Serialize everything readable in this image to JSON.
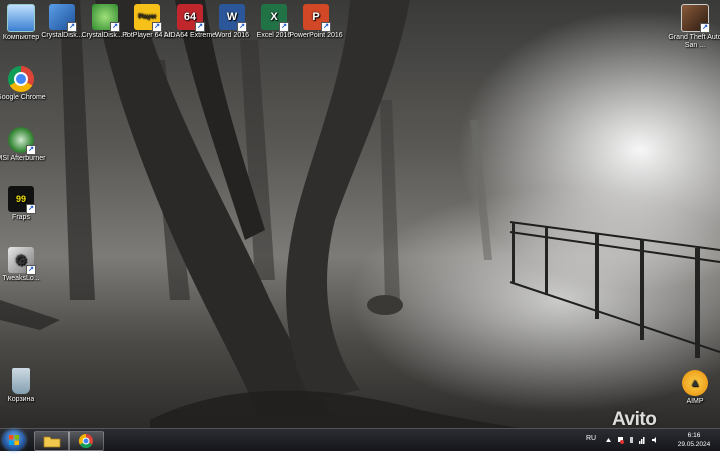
{
  "desktop": {
    "icons": [
      {
        "label": "Компьютер"
      },
      {
        "label": "CrystalDisk..."
      },
      {
        "label": "CrystalDisk... 8"
      },
      {
        "label": "PotPlayer 64 bit"
      },
      {
        "label": "AIDA64 Extreme"
      },
      {
        "label": "Word 2016"
      },
      {
        "label": "Excel 2016"
      },
      {
        "label": "PowerPoint 2016"
      },
      {
        "label": "Google Chrome"
      },
      {
        "label": "MSI Afterburner"
      },
      {
        "label": "Fraps"
      },
      {
        "label": "TweaksLo..."
      },
      {
        "label": "Корзина"
      },
      {
        "label": "Grand Theft Auto San ..."
      },
      {
        "label": "AIMP"
      }
    ],
    "tile_text": {
      "potplayer": "Player",
      "aida": "64",
      "word": "W",
      "excel": "X",
      "ppt": "P",
      "fraps": "99"
    }
  },
  "taskbar": {
    "language": "RU",
    "time": "6:16",
    "date": "29.05.2024"
  },
  "watermark": {
    "text": "Avito"
  },
  "colors": {
    "word": "#2b579a",
    "excel": "#217346",
    "powerpoint": "#d24726",
    "aida": "#c0272d",
    "taskbar": "#15171b"
  }
}
